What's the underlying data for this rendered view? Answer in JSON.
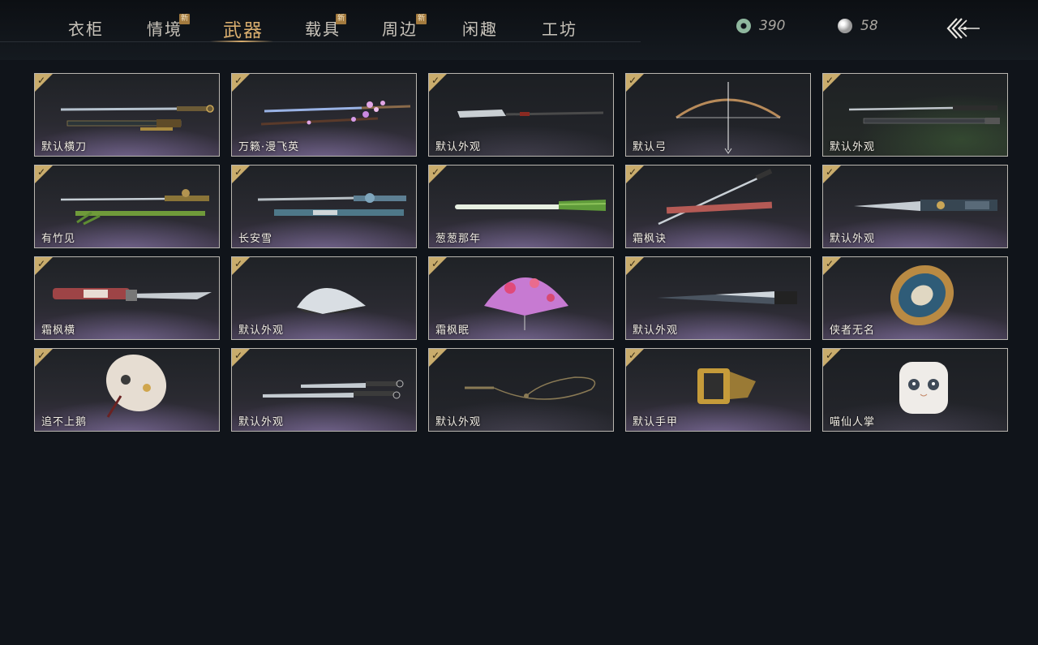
{
  "tabs": [
    {
      "label": "衣柜",
      "new": false
    },
    {
      "label": "情境",
      "new": true
    },
    {
      "label": "武器",
      "new": false,
      "active": true
    },
    {
      "label": "载具",
      "new": true
    },
    {
      "label": "周边",
      "new": true
    },
    {
      "label": "闲趣",
      "new": false
    },
    {
      "label": "工坊",
      "new": false
    }
  ],
  "new_badge": "新",
  "currency": {
    "jade": {
      "icon": "jade-coin-icon",
      "value": "390"
    },
    "pearl": {
      "icon": "pearl-icon",
      "value": "58"
    }
  },
  "back": {
    "icon": "back-arrow-icon"
  },
  "check_mark": "✓",
  "items": [
    {
      "name": "默认横刀",
      "art": "sword"
    },
    {
      "name": "万籁·漫飞英",
      "art": "sword-blossom"
    },
    {
      "name": "默认外观",
      "art": "glaive"
    },
    {
      "name": "默认弓",
      "art": "bow"
    },
    {
      "name": "默认外观",
      "art": "twin-sword"
    },
    {
      "name": "有竹见",
      "art": "bamboo-sword"
    },
    {
      "name": "长安雪",
      "art": "ornate-sword"
    },
    {
      "name": "葱葱那年",
      "art": "scallion"
    },
    {
      "name": "霜枫诀",
      "art": "diagonal-sword"
    },
    {
      "name": "默认外观",
      "art": "dagger"
    },
    {
      "name": "霜枫横",
      "art": "red-dagger"
    },
    {
      "name": "默认外观",
      "art": "fan-white"
    },
    {
      "name": "霜枫眠",
      "art": "fan-pink"
    },
    {
      "name": "默认外观",
      "art": "closed-fan"
    },
    {
      "name": "侠者无名",
      "art": "umbrella-blue"
    },
    {
      "name": "追不上鹅",
      "art": "umbrella-goose"
    },
    {
      "name": "默认外观",
      "art": "twin-blades"
    },
    {
      "name": "默认外观",
      "art": "rope-dart"
    },
    {
      "name": "默认手甲",
      "art": "gauntlet"
    },
    {
      "name": "喵仙人掌",
      "art": "cat-paw"
    }
  ],
  "colors": {
    "background": "#10141a",
    "active_tab": "#d8ad6e",
    "check_badge": "#c9ac6c",
    "card_border": "#b9b6b0"
  }
}
